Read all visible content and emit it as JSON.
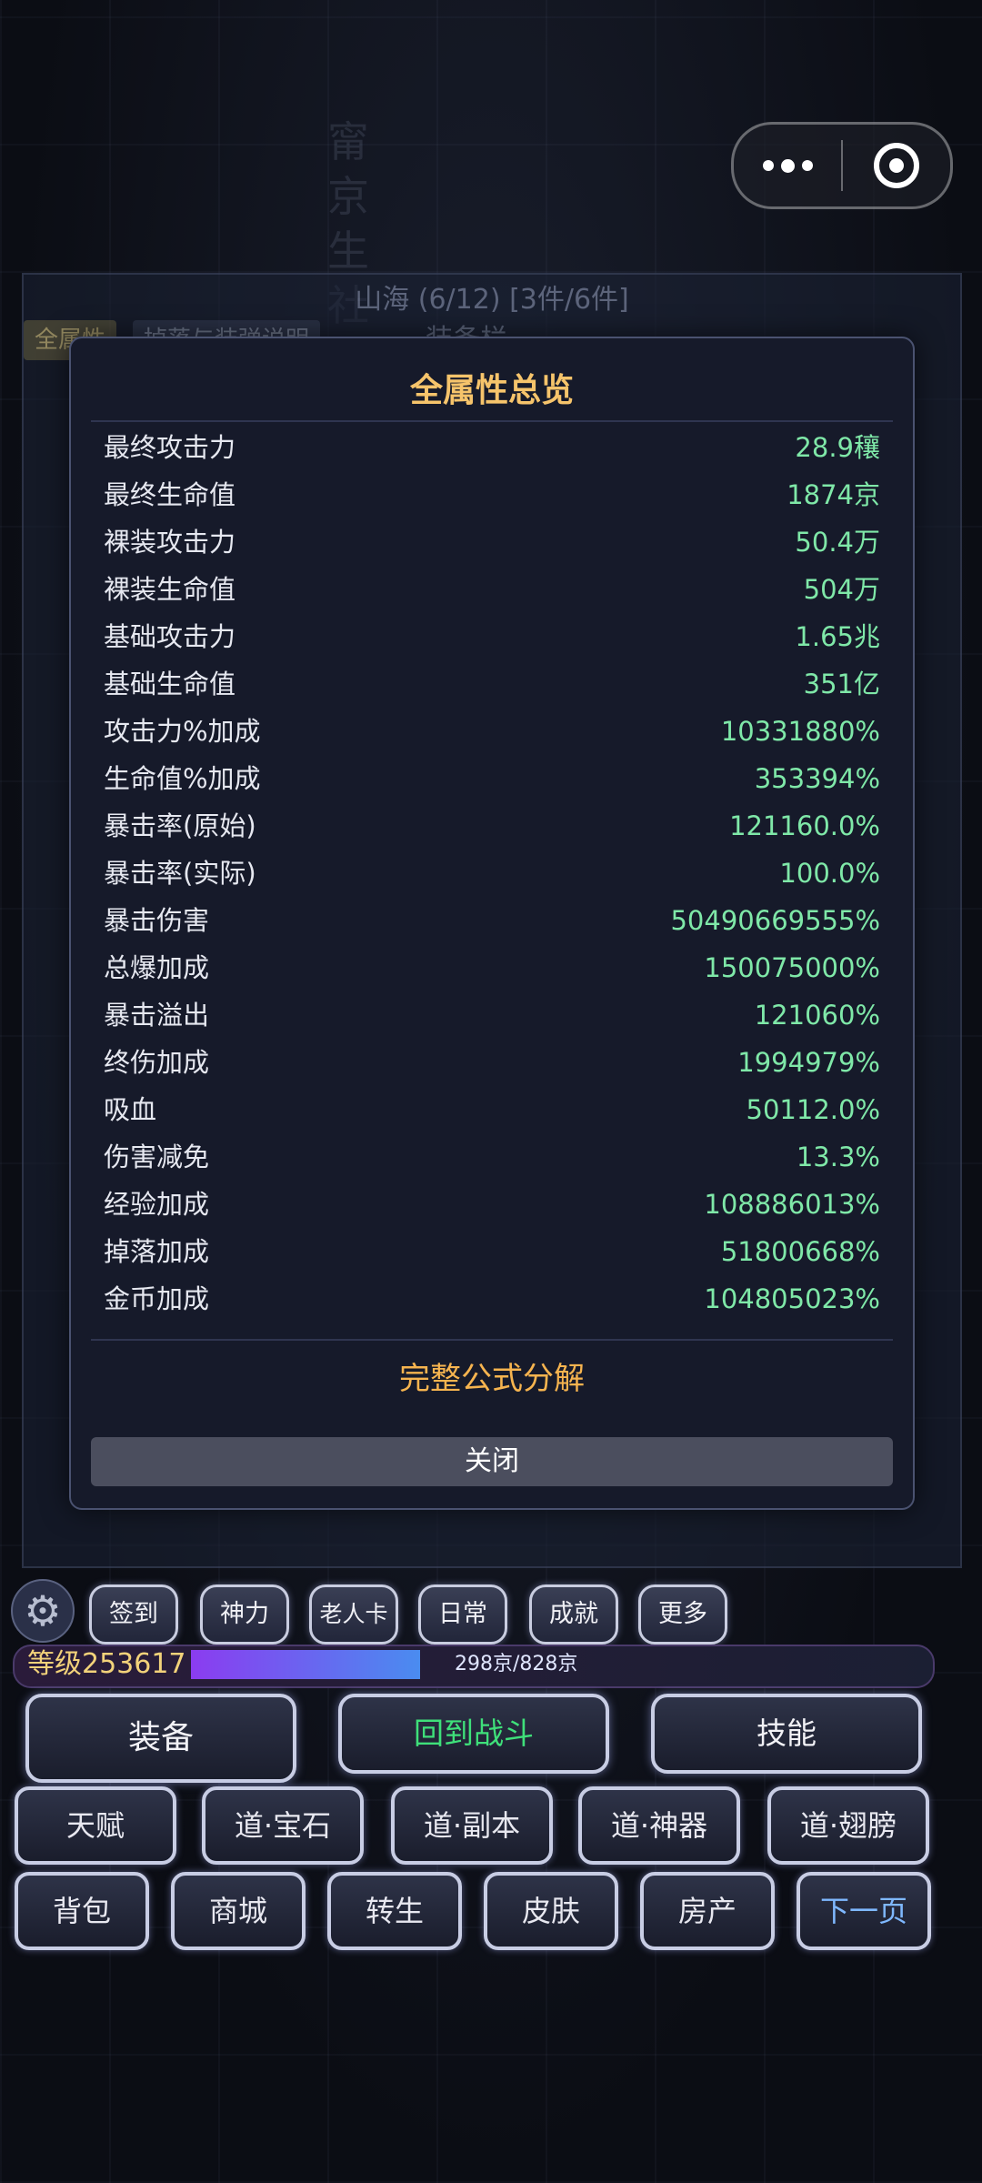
{
  "capsule": {
    "more_icon": "more-dots-icon",
    "close_icon": "target-close-icon"
  },
  "background_panel": {
    "title": "山海 (6/12) [3件/6件]",
    "tab1": "全属性",
    "tab2": "掉落与装弹说明",
    "tab3": "装备栏"
  },
  "modal": {
    "title": "全属性总览",
    "stats": [
      {
        "label": "最终攻击力",
        "value": "28.9穰"
      },
      {
        "label": "最终生命值",
        "value": "1874京"
      },
      {
        "label": "裸装攻击力",
        "value": "50.4万"
      },
      {
        "label": "裸装生命值",
        "value": "504万"
      },
      {
        "label": "基础攻击力",
        "value": "1.65兆"
      },
      {
        "label": "基础生命值",
        "value": "351亿"
      },
      {
        "label": "攻击力%加成",
        "value": "10331880%"
      },
      {
        "label": "生命值%加成",
        "value": "353394%"
      },
      {
        "label": "暴击率(原始)",
        "value": "121160.0%"
      },
      {
        "label": "暴击率(实际)",
        "value": "100.0%"
      },
      {
        "label": "暴击伤害",
        "value": "50490669555%"
      },
      {
        "label": "总爆加成",
        "value": "150075000%"
      },
      {
        "label": "暴击溢出",
        "value": "121060%"
      },
      {
        "label": "终伤加成",
        "value": "1994979%"
      },
      {
        "label": "吸血",
        "value": "50112.0%"
      },
      {
        "label": "伤害减免",
        "value": "13.3%"
      },
      {
        "label": "经验加成",
        "value": "108886013%"
      },
      {
        "label": "掉落加成",
        "value": "51800668%"
      },
      {
        "label": "金币加成",
        "value": "104805023%"
      }
    ],
    "formula_link": "完整公式分解",
    "close_label": "关闭"
  },
  "quick": [
    "签到",
    "神力",
    "老人卡",
    "日常",
    "成就",
    "更多"
  ],
  "level": {
    "label": "等级253617",
    "xp": "298京/828京",
    "progress": 0.36
  },
  "main_buttons": {
    "equip": "装备",
    "battle": "回到战斗",
    "skill": "技能"
  },
  "row2": [
    "天赋",
    "道·宝石",
    "道·副本",
    "道·神器",
    "道·翅膀"
  ],
  "row3": [
    "背包",
    "商城",
    "转生",
    "皮肤",
    "房产",
    "下一页"
  ],
  "colors": {
    "gold": "#f6c46b",
    "green": "#7fe8a8",
    "battle_green": "#3fe07a",
    "next_blue": "#7fb8ff"
  }
}
